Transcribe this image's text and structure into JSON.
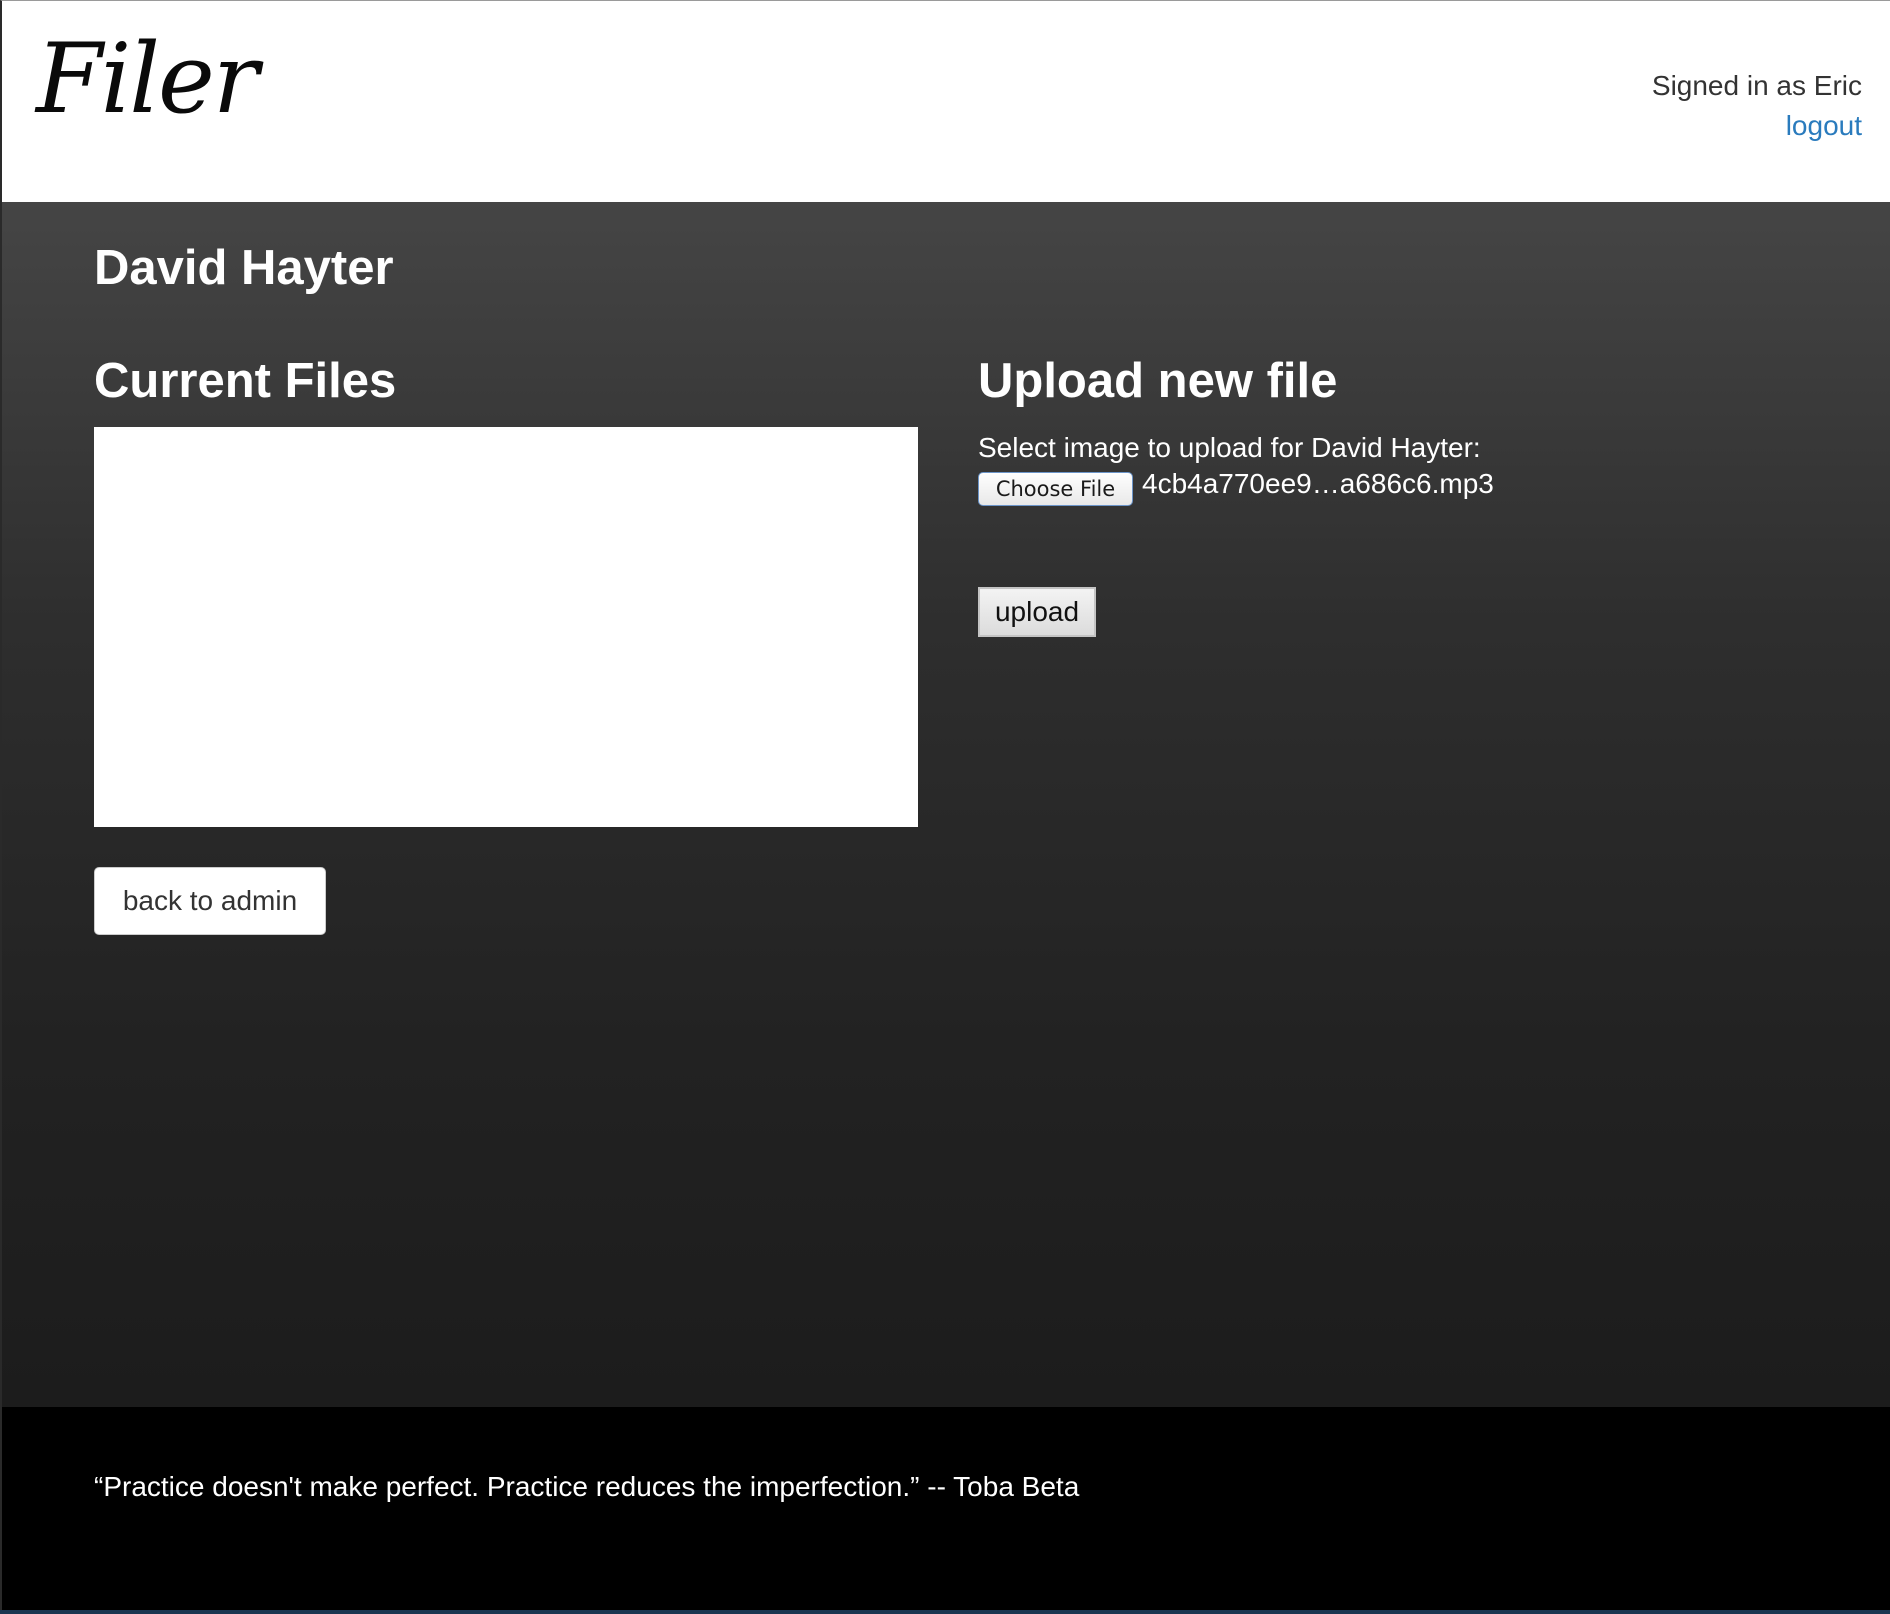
{
  "header": {
    "logo": "Filer",
    "signed_in_text": "Signed in as Eric",
    "logout_label": "logout"
  },
  "main": {
    "page_title": "David Hayter",
    "current_files": {
      "title": "Current Files",
      "back_button_label": "back to admin"
    },
    "upload": {
      "title": "Upload new file",
      "select_label": "Select image to upload for David Hayter:",
      "choose_file_label": "Choose File",
      "selected_file": "4cb4a770ee9…a686c6.mp3",
      "upload_button_label": "upload"
    }
  },
  "footer": {
    "quote": "“Practice doesn't make perfect. Practice reduces the imperfection.” -- Toba Beta"
  },
  "colors": {
    "link": "#2a7bbd",
    "footer_background": "#000000",
    "main_background_top": "#454545",
    "main_background_bottom": "#1c1c1c"
  }
}
